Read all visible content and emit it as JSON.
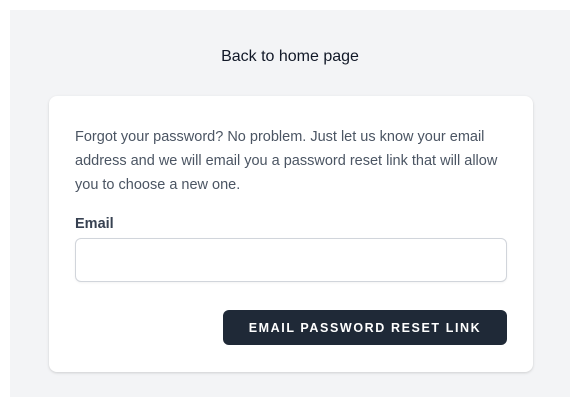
{
  "nav": {
    "home_link": "Back to home page"
  },
  "card": {
    "intro_text": "Forgot your password? No problem. Just let us know your email address and we will email you a password reset link that will allow you to choose a new one.",
    "email_label": "Email",
    "email_value": "",
    "email_placeholder": "",
    "submit_label": "EMAIL PASSWORD RESET LINK"
  },
  "colors": {
    "page_background": "#f3f4f6",
    "card_background": "#ffffff",
    "button_background": "#1f2937",
    "button_text": "#ffffff"
  }
}
